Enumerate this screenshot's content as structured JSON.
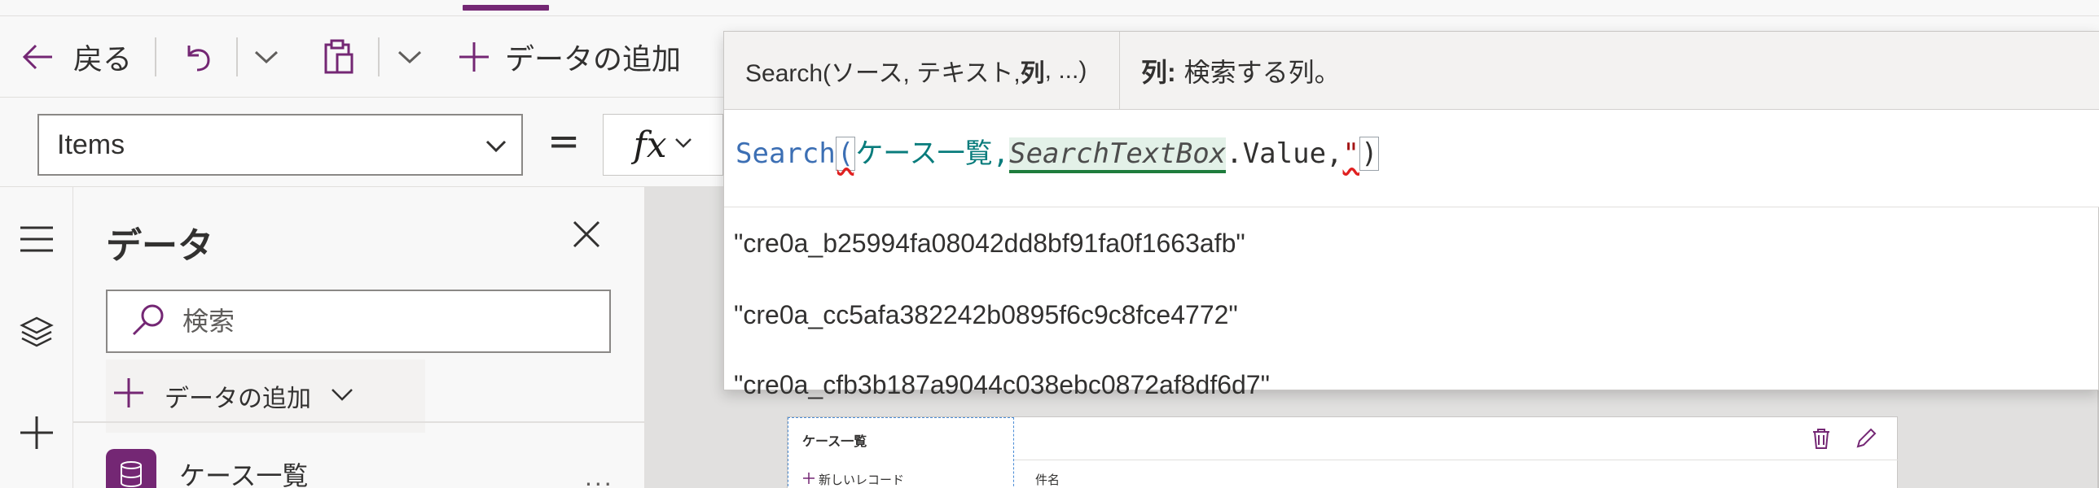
{
  "command_bar": {
    "back_label": "戻る",
    "add_data_label": "データの追加"
  },
  "formula_bar": {
    "property": "Items",
    "equals": "=",
    "fx_label": "fx"
  },
  "intellisense": {
    "signature": "Search(ソース, テキスト, ",
    "signature_bold": "列",
    "signature_tail": ", ...)",
    "param_name": "列:",
    "param_desc": "検索する列。",
    "formula": {
      "fn": "Search",
      "open": "(",
      "datasource": "ケース一覧",
      "comma1": ",",
      "textbox": "SearchTextBox",
      "member": ".Value,",
      "str_quote": "\"",
      "close": ")"
    },
    "suggestions": [
      "\"cre0a_b25994fa08042dd8bf91fa0f1663afb\"",
      "\"cre0a_cc5afa382242b0895f6c9c8fce4772\"",
      "\"cre0a_cfb3b187a9044c038ebc0872af8df6d7\""
    ]
  },
  "data_pane": {
    "title": "データ",
    "search_placeholder": "検索",
    "add_data_label": "データの追加",
    "data_source": "ケース一覧",
    "more": "..."
  },
  "canvas": {
    "gallery_title": "ケース一覧",
    "new_record": "新しいレコード",
    "field_label": "件名"
  },
  "colors": {
    "accent": "#742774",
    "function": "#3c6fb4",
    "datasource": "#097c7c",
    "error": "#e02020"
  }
}
